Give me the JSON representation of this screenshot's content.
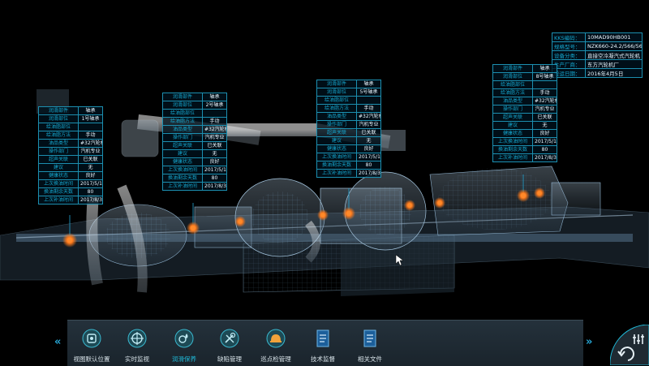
{
  "spec_panel": {
    "rows": [
      {
        "k": "KKS编码：",
        "v": "10MAD90HB001"
      },
      {
        "k": "规格型号：",
        "v": "NZK660-24.2/566/566"
      },
      {
        "k": "设备分类：",
        "v": "直接空冷凝汽式汽轮机"
      },
      {
        "k": "生产厂商：",
        "v": "东方汽轮机厂"
      },
      {
        "k": "投运日期：",
        "v": "2016年4月5日"
      }
    ]
  },
  "bearings": [
    {
      "rows": [
        {
          "k": "润滑部件",
          "v": "轴承"
        },
        {
          "k": "润滑部位",
          "v": "1号轴承"
        },
        {
          "k": "给油脂部位",
          "v": ""
        },
        {
          "k": "给油脂方法",
          "v": "手动"
        },
        {
          "k": "油品类型",
          "v": "#32汽轮机油"
        },
        {
          "k": "操作部门",
          "v": "汽机专业"
        },
        {
          "k": "超声关联",
          "v": "已关联"
        },
        {
          "k": "建议",
          "v": "无"
        },
        {
          "k": "健康状态",
          "v": "良好"
        },
        {
          "k": "上次换油时间",
          "v": "2017/5/10"
        },
        {
          "k": "换油剩余天数",
          "v": "80"
        },
        {
          "k": "上次补油时间",
          "v": "2017/8/3"
        }
      ]
    },
    {
      "rows": [
        {
          "k": "润滑部件",
          "v": "轴承"
        },
        {
          "k": "润滑部位",
          "v": "2号轴承"
        },
        {
          "k": "给油脂部位",
          "v": ""
        },
        {
          "k": "给油脂方法",
          "v": "手动"
        },
        {
          "k": "油品类型",
          "v": "#32汽轮机油"
        },
        {
          "k": "操作部门",
          "v": "汽机专业"
        },
        {
          "k": "超声关联",
          "v": "已关联"
        },
        {
          "k": "建议",
          "v": "无"
        },
        {
          "k": "健康状态",
          "v": "良好"
        },
        {
          "k": "上次换油时间",
          "v": "2017/5/10"
        },
        {
          "k": "换油剩余天数",
          "v": "80"
        },
        {
          "k": "上次补油时间",
          "v": "2017/8/3"
        }
      ]
    },
    {
      "rows": [
        {
          "k": "润滑部件",
          "v": "轴承"
        },
        {
          "k": "润滑部位",
          "v": "5号轴承"
        },
        {
          "k": "给油脂部位",
          "v": ""
        },
        {
          "k": "给油脂方法",
          "v": "手动"
        },
        {
          "k": "油品类型",
          "v": "#32汽轮机油"
        },
        {
          "k": "操作部门",
          "v": "汽机专业"
        },
        {
          "k": "超声关联",
          "v": "已关联"
        },
        {
          "k": "建议",
          "v": "无"
        },
        {
          "k": "健康状态",
          "v": "良好"
        },
        {
          "k": "上次换油时间",
          "v": "2017/5/10"
        },
        {
          "k": "换油剩余天数",
          "v": "80"
        },
        {
          "k": "上次补油时间",
          "v": "2017/8/3"
        }
      ]
    },
    {
      "rows": [
        {
          "k": "润滑部件",
          "v": "轴承"
        },
        {
          "k": "润滑部位",
          "v": "8号轴承"
        },
        {
          "k": "给油脂部位",
          "v": ""
        },
        {
          "k": "给油脂方法",
          "v": "手动"
        },
        {
          "k": "油品类型",
          "v": "#32汽轮机油"
        },
        {
          "k": "操作部门",
          "v": "汽机专业"
        },
        {
          "k": "超声关联",
          "v": "已关联"
        },
        {
          "k": "建议",
          "v": "无"
        },
        {
          "k": "健康状态",
          "v": "良好"
        },
        {
          "k": "上次换油时间",
          "v": "2017/5/10"
        },
        {
          "k": "换油剩余天数",
          "v": "80"
        },
        {
          "k": "上次补油时间",
          "v": "2017/8/3"
        }
      ]
    }
  ],
  "toolbar": {
    "items": [
      {
        "label": "视图默认位置",
        "icon": "target-icon",
        "active": false
      },
      {
        "label": "实时监视",
        "icon": "monitor-icon",
        "active": false
      },
      {
        "label": "润滑保养",
        "icon": "oil-drop-icon",
        "active": true
      },
      {
        "label": "缺陷管理",
        "icon": "wrench-icon",
        "active": false
      },
      {
        "label": "巡点检管理",
        "icon": "helmet-icon",
        "active": false
      },
      {
        "label": "技术监督",
        "icon": "document-icon",
        "active": false
      },
      {
        "label": "相关文件",
        "icon": "file-icon",
        "active": false
      }
    ],
    "left_arrow": "«",
    "right_arrow": "»"
  },
  "colors": {
    "accent": "#1fb6d4",
    "table_border": "#1c8fb0",
    "key_text": "#14a6ce",
    "marker": "#ff7a1a"
  }
}
